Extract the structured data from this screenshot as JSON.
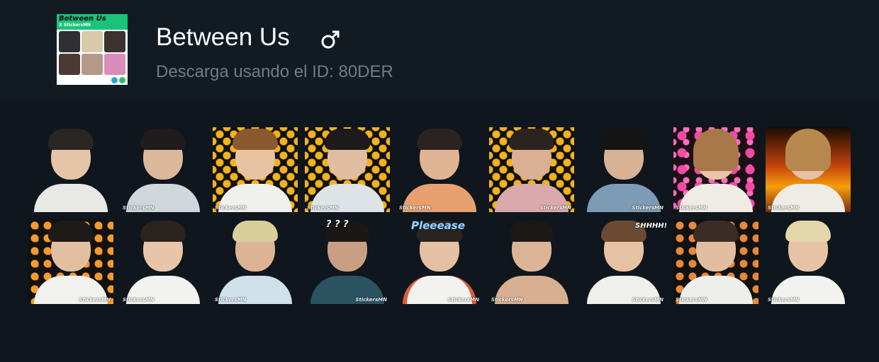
{
  "pack": {
    "thumbnail": {
      "title": "Between Us",
      "subtitle": "X StickersMN",
      "icons": [
        "telegram-icon",
        "whatsapp-icon"
      ]
    },
    "title": "Between Us",
    "gender_icon": "male-symbol-icon",
    "id_label": "Descarga usando el ID: 80DER"
  },
  "colors": {
    "page_background": "#0f161d",
    "header_background": "#131b22",
    "title": "#ffffff",
    "subtitle": "#727a82",
    "thumb_band": "#19c37a"
  },
  "stickers": {
    "watermark": "StickersMN",
    "row1": [
      {
        "name": "sticker-pouting-boy",
        "background": "transparent"
      },
      {
        "name": "sticker-smiling-boy-open-shirt",
        "background": "transparent"
      },
      {
        "name": "sticker-laughing-emoji-boy",
        "background": "laughing-emoji"
      },
      {
        "name": "sticker-thinking-emoji-boy",
        "background": "thinking-emoji"
      },
      {
        "name": "sticker-peach-shirt-boy",
        "background": "transparent"
      },
      {
        "name": "sticker-laughing-hands-boy",
        "background": "laughing-emoji"
      },
      {
        "name": "sticker-glasses-loading-boy",
        "background": "transparent"
      },
      {
        "name": "sticker-hearts-girl",
        "background": "hearts"
      },
      {
        "name": "sticker-fire-girl",
        "background": "fire"
      }
    ],
    "row2": [
      {
        "name": "sticker-annoyed-faces-boy",
        "background": "faces"
      },
      {
        "name": "sticker-grinning-boy",
        "background": "transparent"
      },
      {
        "name": "sticker-blonde-crying-boy",
        "background": "transparent"
      },
      {
        "name": "sticker-question-cup-boy",
        "background": "transparent",
        "text": "? ? ?"
      },
      {
        "name": "sticker-pleeease-boy",
        "background": "transparent",
        "text": "Pleeease"
      },
      {
        "name": "sticker-goggles-boy",
        "background": "transparent"
      },
      {
        "name": "sticker-shhh-boy",
        "background": "transparent",
        "text": "SHHHH!"
      },
      {
        "name": "sticker-cake-laugh-boy",
        "background": "cakes"
      },
      {
        "name": "sticker-blonde-smile-boy",
        "background": "transparent"
      }
    ]
  }
}
